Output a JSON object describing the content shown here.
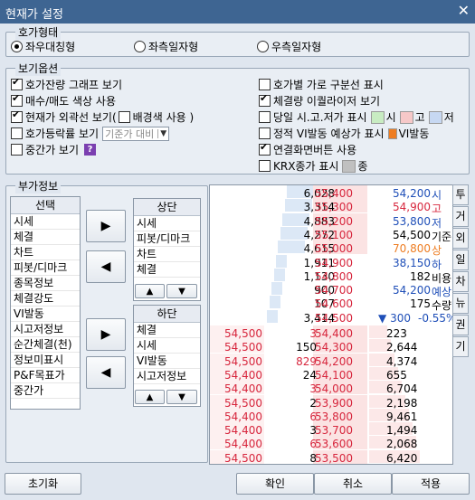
{
  "window": {
    "title": "현재가 설정",
    "close": "✕"
  },
  "hoga_type": {
    "label": "호가형태",
    "options": [
      {
        "label": "좌우대칭형",
        "selected": true
      },
      {
        "label": "좌측일자형",
        "selected": false
      },
      {
        "label": "우측일자형",
        "selected": false
      }
    ]
  },
  "display_options": {
    "label": "보기옵션",
    "left": [
      {
        "label": "호가잔량 그래프 보기",
        "checked": true
      },
      {
        "label": "매수/매도 색상 사용",
        "checked": true
      },
      {
        "label": "현재가 외곽선 보기(",
        "checked": true,
        "sub_label": "배경색 사용 )",
        "sub_checked": false
      },
      {
        "label": "호가등락률 보기",
        "checked": false,
        "dropdown": "기준가 대비"
      },
      {
        "label": "중간가 보기",
        "checked": false
      }
    ],
    "right": [
      {
        "label": "호가별 가로 구분선 표시",
        "checked": false
      },
      {
        "label": "체결량 이퀄라이저 보기",
        "checked": true
      },
      {
        "label": "당일 시.고.저가 표시",
        "checked": false,
        "swatches": [
          {
            "color": "#c8ecc2",
            "label": "시"
          },
          {
            "color": "#f6c8c8",
            "label": "고"
          },
          {
            "color": "#c7d8f2",
            "label": "저"
          }
        ]
      },
      {
        "label": "정적 VI발동 예상가 표시",
        "checked": false,
        "swatches": [
          {
            "color": "#ee7d22",
            "label": "VI발동"
          }
        ]
      },
      {
        "label": "연결화면버튼 사용",
        "checked": true
      },
      {
        "label": "KRX종가 표시",
        "checked": false,
        "swatches": [
          {
            "color": "#c0c0c0",
            "label": "종"
          }
        ]
      }
    ]
  },
  "extra_info": {
    "label": "부가정보",
    "selection_header": "선택",
    "selection_items": [
      "시세",
      "체결",
      "차트",
      "피봇/디마크",
      "종목정보",
      "체결강도",
      "VI발동",
      "시고저정보",
      "순간체결(천)",
      "정보미표시",
      "P&F목표가",
      "중간가"
    ],
    "top_header": "상단",
    "top_items": [
      "시세",
      "피봇/디마크",
      "차트",
      "체결"
    ],
    "bottom_header": "하단",
    "bottom_items": [
      "체결",
      "시세",
      "VI발동",
      "시고저정보"
    ],
    "arrow_right": "▶",
    "arrow_left": "◀",
    "up": "▲",
    "down": "▼"
  },
  "preview": {
    "sell_rows": [
      {
        "qty": "6,028",
        "price": "55,400",
        "info_val": "54,200",
        "info_lbl": "시"
      },
      {
        "qty": "3,314",
        "price": "55,300",
        "info_val": "54,900",
        "info_lbl": "고"
      },
      {
        "qty": "4,883",
        "price": "55,200",
        "info_val": "53,800",
        "info_lbl": "저"
      },
      {
        "qty": "4,272",
        "price": "55,100",
        "info_val": "54,500",
        "info_lbl": "기준"
      },
      {
        "qty": "4,615",
        "price": "55,000",
        "info_val": "70,800",
        "info_lbl": "상"
      },
      {
        "qty": "1,911",
        "price": "54,900",
        "info_val": "38,150",
        "info_lbl": "하"
      },
      {
        "qty": "1,130",
        "price": "54,800",
        "info_val": "182",
        "info_lbl": "비용"
      },
      {
        "qty": "900",
        "price": "54,700",
        "info_val": "54,200",
        "info_lbl": "예상"
      },
      {
        "qty": "107",
        "price": "54,600",
        "info_val": "175",
        "info_lbl": "수량"
      },
      {
        "qty": "3,414",
        "price": "54,500",
        "info_val": "▼ 300",
        "info_lbl": "-0.55%"
      }
    ],
    "buy_rows": [
      {
        "tick": "54,500",
        "tick_qty": "3",
        "price": "54,400",
        "qty": "223"
      },
      {
        "tick": "54,500",
        "tick_qty": "150",
        "price": "54,300",
        "qty": "2,644"
      },
      {
        "tick": "54,500",
        "tick_qty": "829",
        "price": "54,200",
        "qty": "4,374"
      },
      {
        "tick": "54,400",
        "tick_qty": "24",
        "price": "54,100",
        "qty": "655"
      },
      {
        "tick": "54,400",
        "tick_qty": "3",
        "price": "54,000",
        "qty": "6,704"
      },
      {
        "tick": "54,500",
        "tick_qty": "2",
        "price": "53,900",
        "qty": "2,198"
      },
      {
        "tick": "54,400",
        "tick_qty": "6",
        "price": "53,800",
        "qty": "9,461"
      },
      {
        "tick": "54,400",
        "tick_qty": "3",
        "price": "53,700",
        "qty": "1,494"
      },
      {
        "tick": "54,400",
        "tick_qty": "6",
        "price": "53,600",
        "qty": "2,068"
      },
      {
        "tick": "54,500",
        "tick_qty": "8",
        "price": "53,500",
        "qty": "6,420"
      }
    ],
    "side_tabs": [
      "투",
      "거",
      "외",
      "일",
      "차",
      "뉴",
      "권",
      "기"
    ]
  },
  "footer": {
    "reset": "초기화",
    "ok": "확인",
    "cancel": "취소",
    "apply": "적용"
  },
  "colors": {
    "sell": "#1f4fb8",
    "buy": "#d7263d",
    "title_bar": "#3e6592"
  }
}
